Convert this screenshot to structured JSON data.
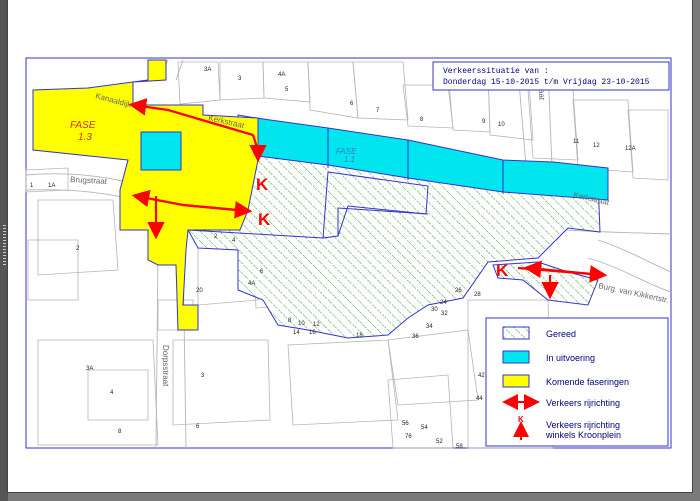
{
  "info_box": {
    "line1": "Verkeerssituatie van :",
    "line2": "Donderdag 15-10-2015 t/m Vrijdag 23-10-2015"
  },
  "streets": {
    "kanaaldijk": "Kanaaldijk",
    "kerkstraat_w": "Kerkstraat",
    "brugstraat": "Brugstraat",
    "kerkstraat_e": "Kerkstraat",
    "kikkert": "Burg. van Kikkertstr.",
    "dorpsstraat": "Dorpsstraat",
    "top_street": "straat"
  },
  "fase_yellow": {
    "label": "FASE",
    "number": "1.3"
  },
  "fase_cyan": {
    "label": "FASE",
    "number": "1.1"
  },
  "k_marker": "K",
  "house_numbers": {
    "n3a": "3A",
    "n3": "3",
    "n4a": "4A",
    "n5": "5",
    "n6": "6",
    "n7": "7",
    "n8": "8",
    "n9": "9",
    "n10": "10",
    "n11": "11",
    "n12": "12",
    "n12a": "12A",
    "n1": "1",
    "n1a": "1A",
    "n2": "2",
    "n2b": "2",
    "n4": "4",
    "n4a2": "4A",
    "n6b": "6",
    "n20": "20",
    "n24": "24",
    "n26": "26",
    "n28": "28",
    "n30": "30",
    "n32": "32",
    "n34": "34",
    "n36": "36",
    "n18": "18",
    "n16": "16",
    "n14": "14",
    "n12b": "12",
    "n10b": "10",
    "n8b": "8",
    "n3a2": "3A",
    "n4b": "4",
    "n8c": "8",
    "n3b": "3",
    "n6c": "6",
    "n42": "42",
    "n44": "44",
    "n56": "56",
    "n54": "54",
    "n76": "76",
    "n52": "52",
    "n58": "58"
  },
  "legend": {
    "items": [
      {
        "label": "Gereed",
        "color": "#33aa33"
      },
      {
        "label": "In uitvoering",
        "color": "#00e5ee"
      },
      {
        "label": "Komende faseringen",
        "color": "#ffff00"
      },
      {
        "label": "Verkeers rijrichting",
        "color": "#ff0000"
      },
      {
        "label_line1": "Verkeers rijrichting",
        "label_line2": "winkels Kroonplein",
        "k": "K",
        "color": "#ff0000"
      }
    ]
  },
  "colors": {
    "border": "#3333cc",
    "yellow": "#ffff00",
    "cyan": "#00e5ee",
    "hatch": "#33aa33",
    "arrow": "#ff0000"
  }
}
